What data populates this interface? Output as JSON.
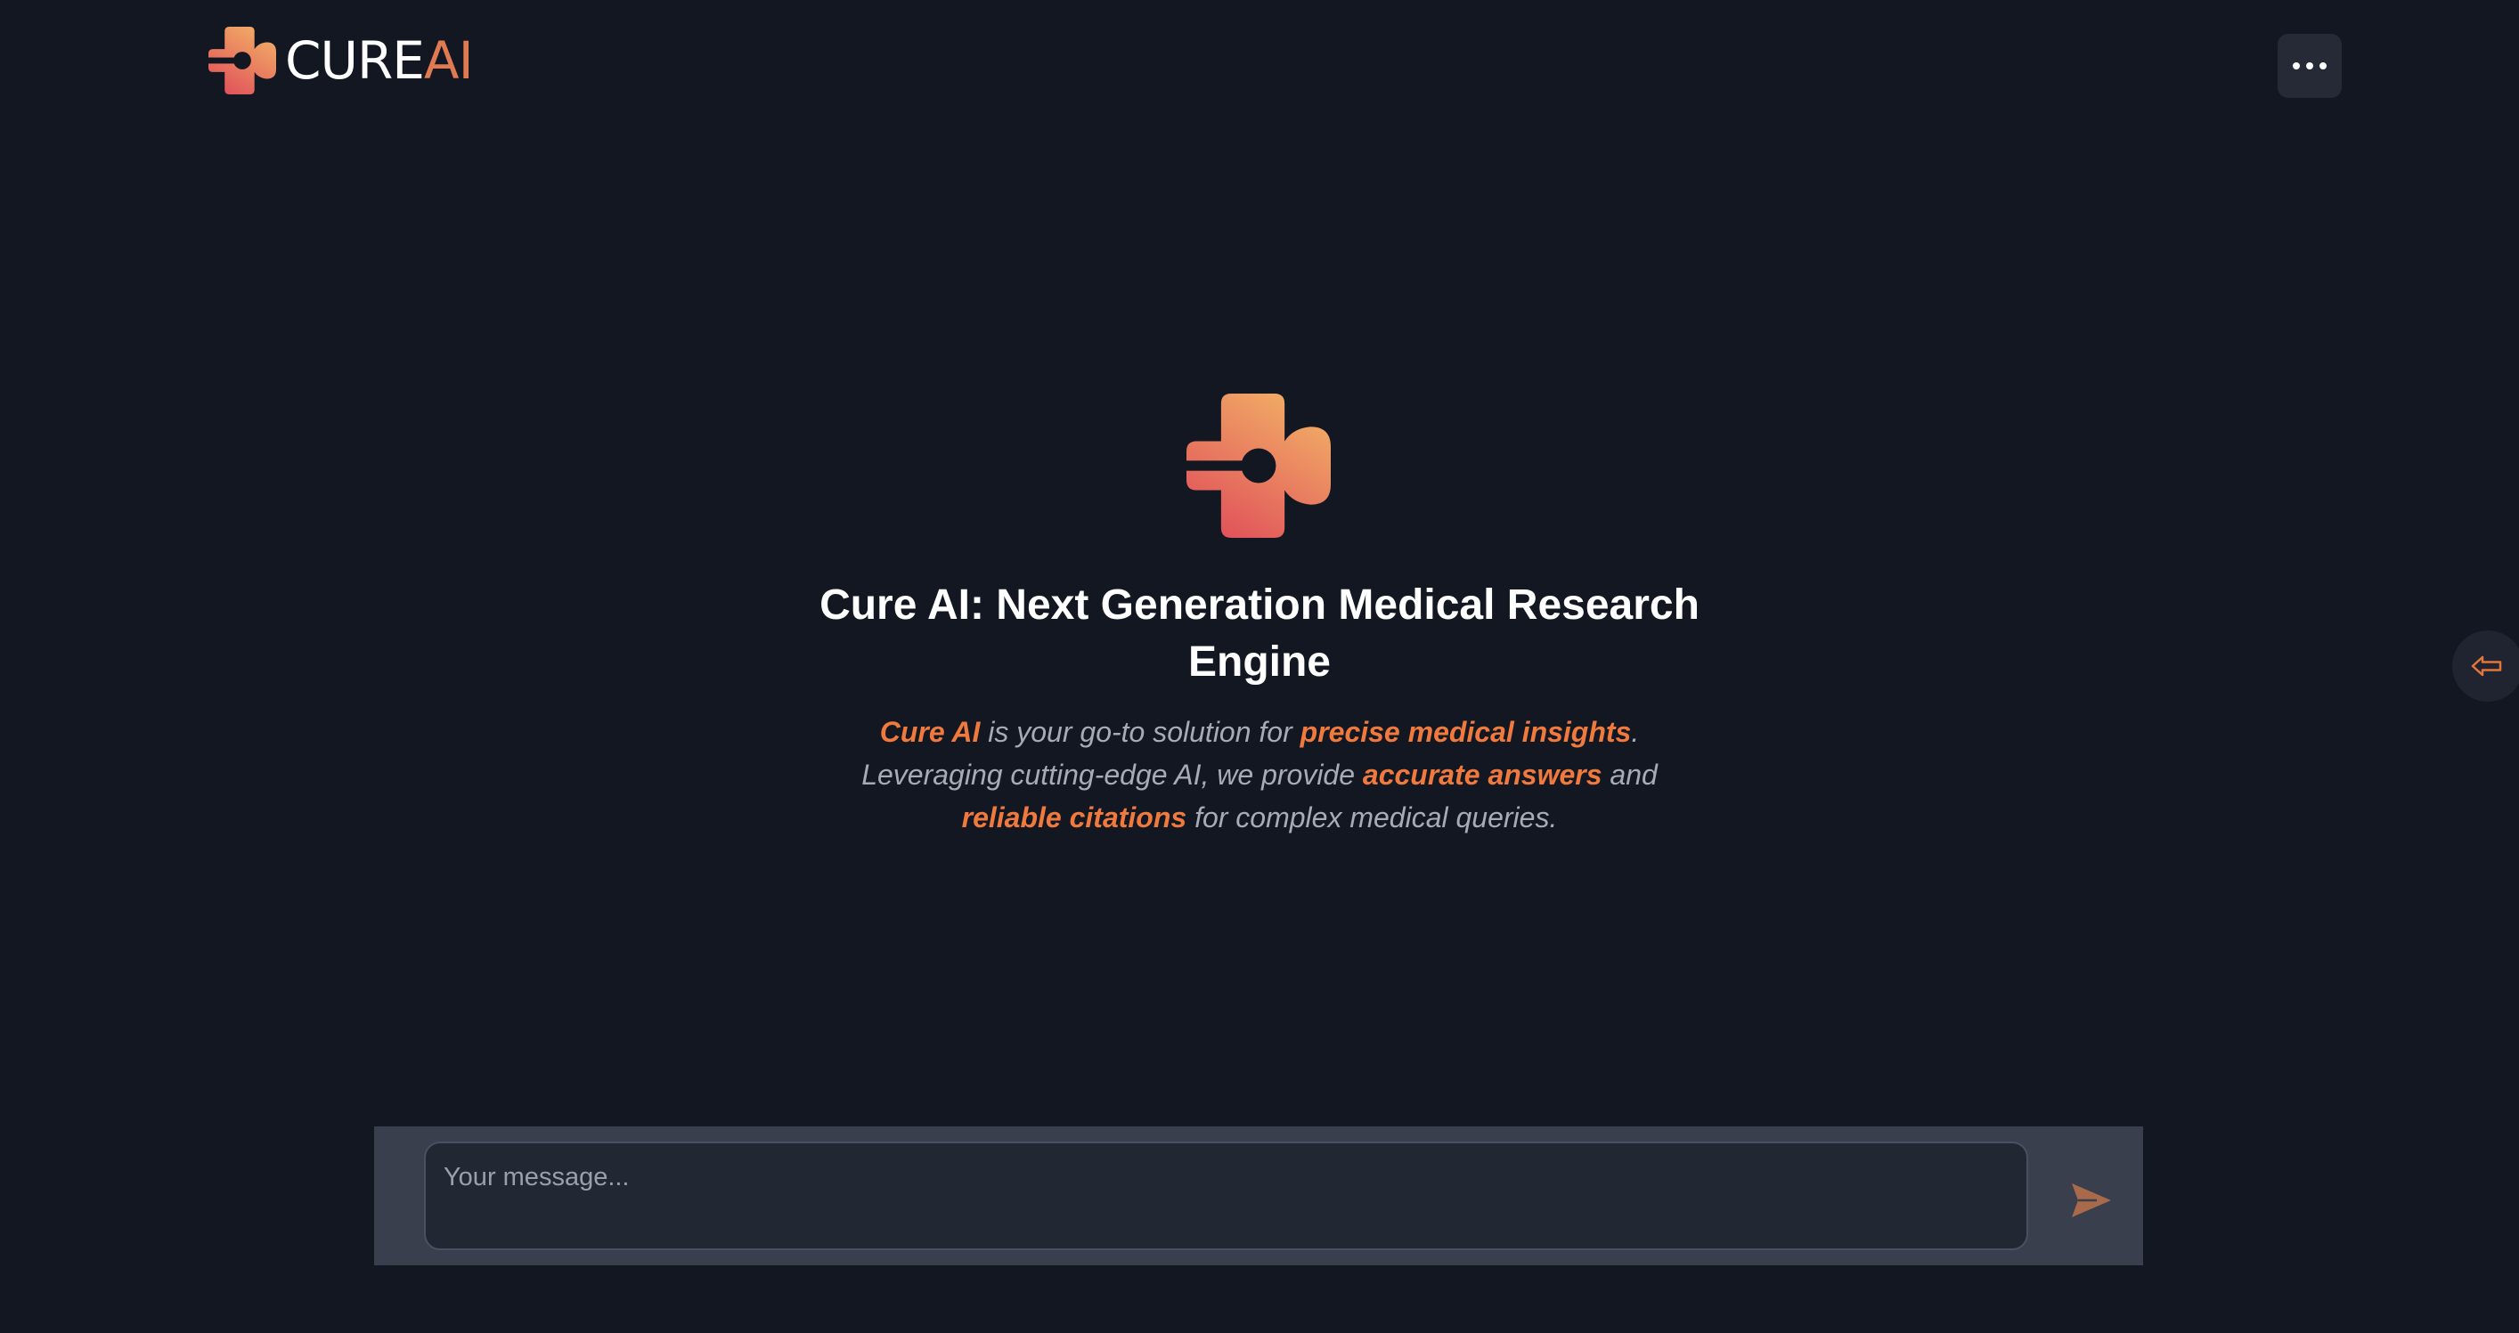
{
  "brand": {
    "name_part1": "CURE",
    "name_part2": "AI",
    "logo_icon": "cure-ai-cross-logo",
    "gradient_top": "#f2b066",
    "gradient_bottom": "#e0505a",
    "accent_text": "#e07a52"
  },
  "header": {
    "menu_icon": "more-horizontal-icon"
  },
  "hero": {
    "title": "Cure AI: Next Generation Medical Research Engine",
    "description": [
      {
        "text": "Cure AI",
        "highlight": true
      },
      {
        "text": " is your go-to solution for ",
        "highlight": false
      },
      {
        "text": "precise medical insights",
        "highlight": true
      },
      {
        "text": ". Leveraging cutting-edge AI, we provide ",
        "highlight": false
      },
      {
        "text": "accurate answers",
        "highlight": true
      },
      {
        "text": " and ",
        "highlight": false
      },
      {
        "text": "reliable citations",
        "highlight": true
      },
      {
        "text": " for complex medical queries.",
        "highlight": false
      }
    ],
    "highlight_color": "#f07a3d"
  },
  "side_panel": {
    "toggle_icon": "arrow-left-outline-icon"
  },
  "composer": {
    "placeholder": "Your message...",
    "value": "",
    "send_icon": "send-icon"
  },
  "colors": {
    "background": "#131722",
    "composer_bar": "#3a3f4d",
    "input_background": "#222734",
    "send_icon": "#a86a4a",
    "toggle_arrow": "#e2763a"
  }
}
